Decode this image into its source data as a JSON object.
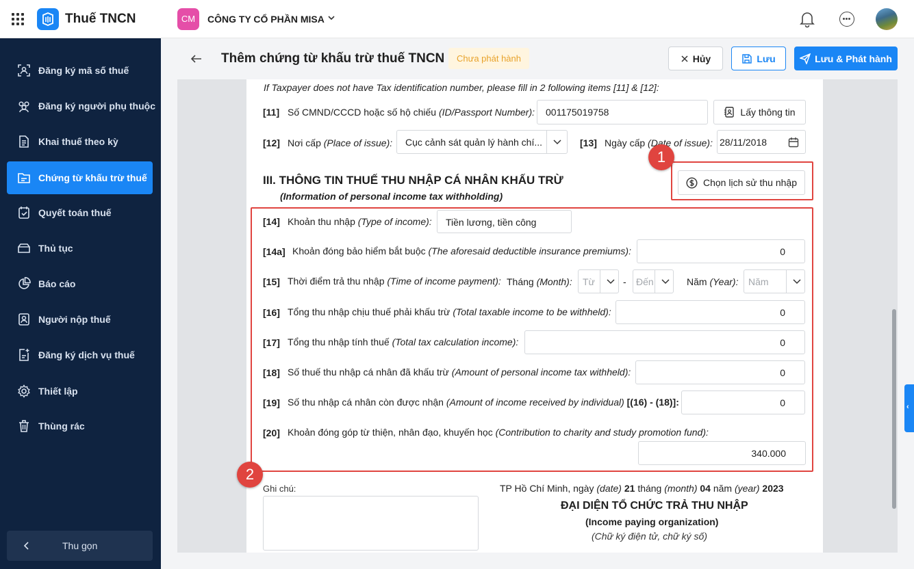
{
  "app": {
    "title": "Thuế TNCN"
  },
  "company": {
    "badge": "CM",
    "name": "CÔNG TY CỔ PHẦN MISA"
  },
  "sidebar": {
    "items": [
      {
        "label": "Đăng ký mã số thuế",
        "icon": "id-scan-icon"
      },
      {
        "label": "Đăng ký người phụ thuộc",
        "icon": "users-icon"
      },
      {
        "label": "Khai thuế theo kỳ",
        "icon": "document-icon"
      },
      {
        "label": "Chứng từ khấu trừ thuế",
        "icon": "folder-icon",
        "active": true
      },
      {
        "label": "Quyết toán thuế",
        "icon": "calendar-check-icon"
      },
      {
        "label": "Thủ tục",
        "icon": "folder-outline-icon"
      },
      {
        "label": "Báo cáo",
        "icon": "pie-chart-icon"
      },
      {
        "label": "Người nộp thuế",
        "icon": "person-card-icon"
      },
      {
        "label": "Đăng ký dịch vụ thuế",
        "icon": "document-add-icon"
      },
      {
        "label": "Thiết lập",
        "icon": "gear-icon"
      },
      {
        "label": "Thùng rác",
        "icon": "trash-icon"
      }
    ],
    "collapse_label": "Thu gọn"
  },
  "header": {
    "title": "Thêm chứng từ khấu trừ thuế TNCN",
    "status": "Chưa phát hành",
    "cancel_label": "Hủy",
    "save_label": "Lưu",
    "publish_label": "Lưu & Phát hành"
  },
  "form": {
    "note_top": "If Taxpayer does not have Tax identification number, please fill in 2 following items [11] & [12]:",
    "f11": {
      "num": "[11]",
      "label": "Số CMND/CCCD hoặc số hộ chiếu",
      "label_en": "(ID/Passport Number):",
      "value": "001175019758",
      "button": "Lấy thông tin"
    },
    "f12": {
      "num": "[12]",
      "label": "Nơi cấp",
      "label_en": "(Place of issue):",
      "value": "Cục cảnh sát quản lý hành chí..."
    },
    "f13": {
      "num": "[13]",
      "label": "Ngày cấp",
      "label_en": "(Date of issue):",
      "value": "28/11/2018"
    },
    "section3": {
      "title": "III. THÔNG TIN THUẾ THU NHẬP CÁ NHÂN KHẤU TRỪ",
      "subtitle": "(Information of personal income tax withholding)",
      "button": "Chọn lịch sử thu nhập"
    },
    "f14": {
      "num": "[14]",
      "label": "Khoản thu nhập",
      "label_en": "(Type of income):",
      "value": "Tiền lương, tiền công"
    },
    "f14a": {
      "num": "[14a]",
      "label": "Khoản đóng bảo hiểm bắt buộc",
      "label_en": "(The aforesaid deductible insurance premiums):",
      "value": "0"
    },
    "f15": {
      "num": "[15]",
      "label": "Thời điểm trả thu nhập",
      "label_en": "(Time of income payment):",
      "month_label": "Tháng",
      "month_label_en": "(Month):",
      "from_placeholder": "Từ",
      "dash": "-",
      "to_placeholder": "Đến",
      "year_label": "Năm",
      "year_label_en": "(Year):",
      "year_placeholder": "Năm"
    },
    "f16": {
      "num": "[16]",
      "label": "Tổng thu nhập chịu thuế phải khấu trừ",
      "label_en": "(Total taxable income to be withheld):",
      "value": "0"
    },
    "f17": {
      "num": "[17]",
      "label": "Tổng thu nhập tính thuế",
      "label_en": "(Total tax calculation income):",
      "value": "0"
    },
    "f18": {
      "num": "[18]",
      "label": "Số thuế thu nhập cá nhân đã khấu trừ",
      "label_en": "(Amount of personal income tax withheld):",
      "value": "0"
    },
    "f19": {
      "num": "[19]",
      "label": "Số thu nhập cá nhân còn được nhận",
      "label_en": "(Amount of income received by individual)",
      "formula": "[(16) - (18)]:",
      "value": "0"
    },
    "f20": {
      "num": "[20]",
      "label": "Khoản đóng góp từ thiện, nhân đạo, khuyến học",
      "label_en": "(Contribution to charity and study promotion fund):",
      "value": "340.000"
    },
    "note_label": "Ghi chú:",
    "date_line": {
      "place": "TP Hồ Chí Minh, ngày",
      "date_en": "(date)",
      "day": "21",
      "month_vn": "tháng",
      "month_en": "(month)",
      "month": "04",
      "year_vn": "năm",
      "year_en": "(year)",
      "year": "2023"
    },
    "signer": {
      "title": "ĐẠI DIỆN TỔ CHỨC TRẢ THU NHẬP",
      "title_en": "(Income paying organization)",
      "note": "(Chữ ký điện tử, chữ ký số)"
    }
  },
  "annotations": {
    "marker1": "1",
    "marker2": "2"
  },
  "colors": {
    "primary": "#1a86f5",
    "sidebar_bg": "#0f2340",
    "highlight": "#e0443f",
    "badge_bg": "#fff5df",
    "badge_text": "#e8a22b"
  }
}
